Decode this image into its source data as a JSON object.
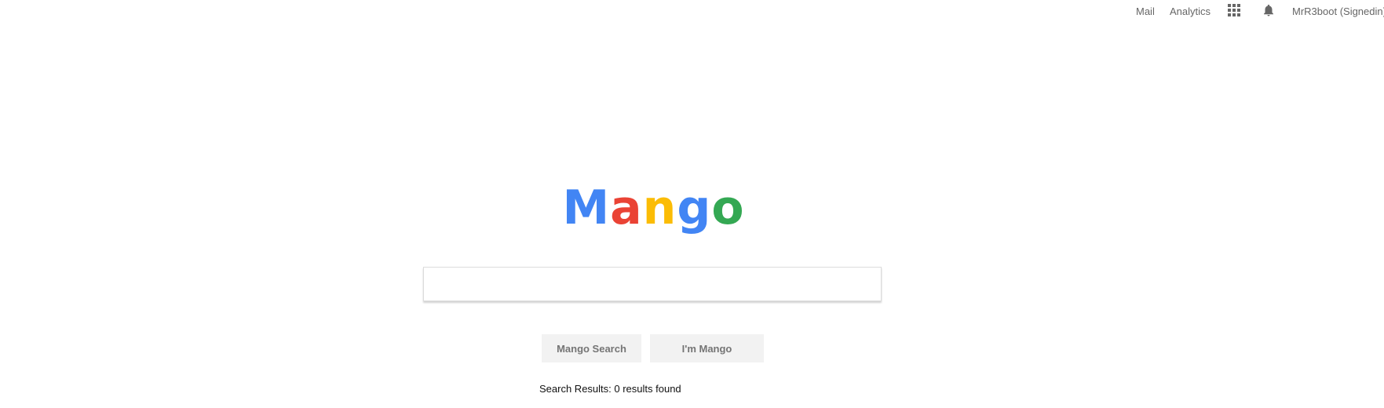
{
  "topnav": {
    "mail_label": "Mail",
    "analytics_label": "Analytics",
    "apps_icon": "apps-grid-icon",
    "notifications_icon": "bell-icon",
    "user_label": "MrR3boot (Signedin)"
  },
  "logo": {
    "letters": [
      "M",
      "a",
      "n",
      "g",
      "o"
    ],
    "colors": [
      "#4285F4",
      "#EA4335",
      "#FBBC05",
      "#4285F4",
      "#34A853"
    ]
  },
  "search": {
    "value": "",
    "placeholder": ""
  },
  "buttons": {
    "search_label": "Mango Search",
    "lucky_label": "I'm Mango"
  },
  "results": {
    "text": "Search Results: 0 results found"
  }
}
